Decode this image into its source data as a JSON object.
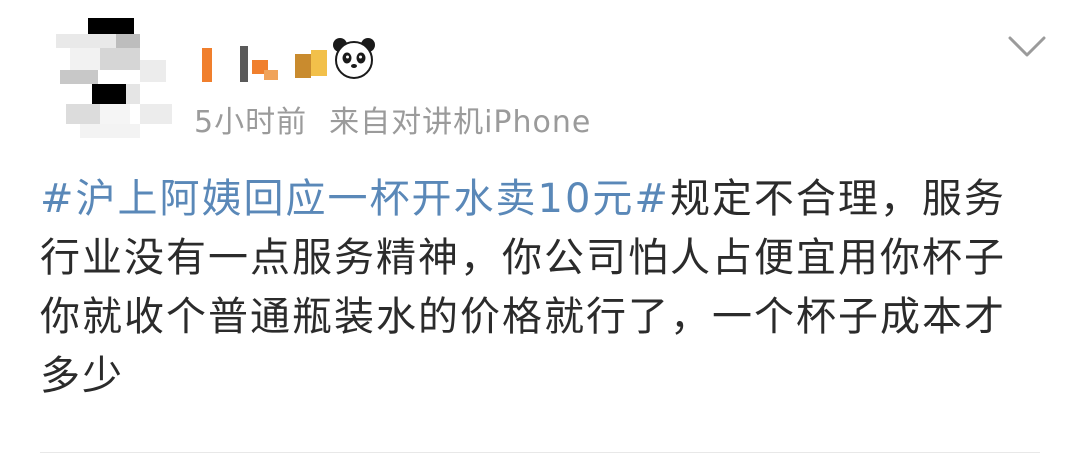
{
  "post": {
    "time": "5小时前",
    "source_prefix": "来自",
    "source": "对讲机iPhone",
    "hashtag": "#沪上阿姨回应一杯开水卖10元#",
    "body_text": "规定不合理，服务行业没有一点服务精神，你公司怕人占便宜用你杯子你就收个普通瓶装水的价格就行了，一个杯子成本才多少"
  },
  "colors": {
    "hashtag": "#5a88b8",
    "meta": "#9b9b9b",
    "text": "#2b2b2b"
  },
  "icons": {
    "user_badge": "panda-icon",
    "more": "chevron-down-icon"
  }
}
